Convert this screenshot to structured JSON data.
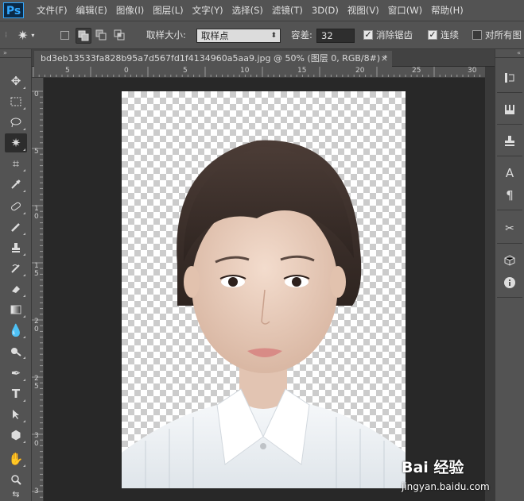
{
  "app": {
    "logo": "Ps"
  },
  "menu": [
    "文件(F)",
    "编辑(E)",
    "图像(I)",
    "图层(L)",
    "文字(Y)",
    "选择(S)",
    "滤镜(T)",
    "3D(D)",
    "视图(V)",
    "窗口(W)",
    "帮助(H)"
  ],
  "options": {
    "sample_size_label": "取样大小:",
    "sample_size_value": "取样点",
    "tolerance_label": "容差:",
    "tolerance_value": "32",
    "antialias_label": "消除锯齿",
    "contiguous_label": "连续",
    "all_layers_label": "对所有图"
  },
  "document": {
    "tab_title": "bd3eb13533fa828b95a7d567fd1f4134960a5aa9.jpg @ 50% (图层 0, RGB/8#) *",
    "close": "×"
  },
  "rulers": {
    "top": [
      "5",
      "0",
      "5",
      "10",
      "15",
      "20",
      "25",
      "30"
    ],
    "left": [
      "0",
      "5",
      "1",
      "0",
      "1",
      "5",
      "2",
      "0",
      "2",
      "5",
      "3",
      "0",
      "3"
    ]
  },
  "watermark": {
    "logo": "Bai 经验",
    "url": "jingyan.baidu.com"
  },
  "colors": {
    "panel": "#535353",
    "canvas_bg": "#282828",
    "checker": "#cccccc",
    "ps_blue": "#31a8ff"
  }
}
